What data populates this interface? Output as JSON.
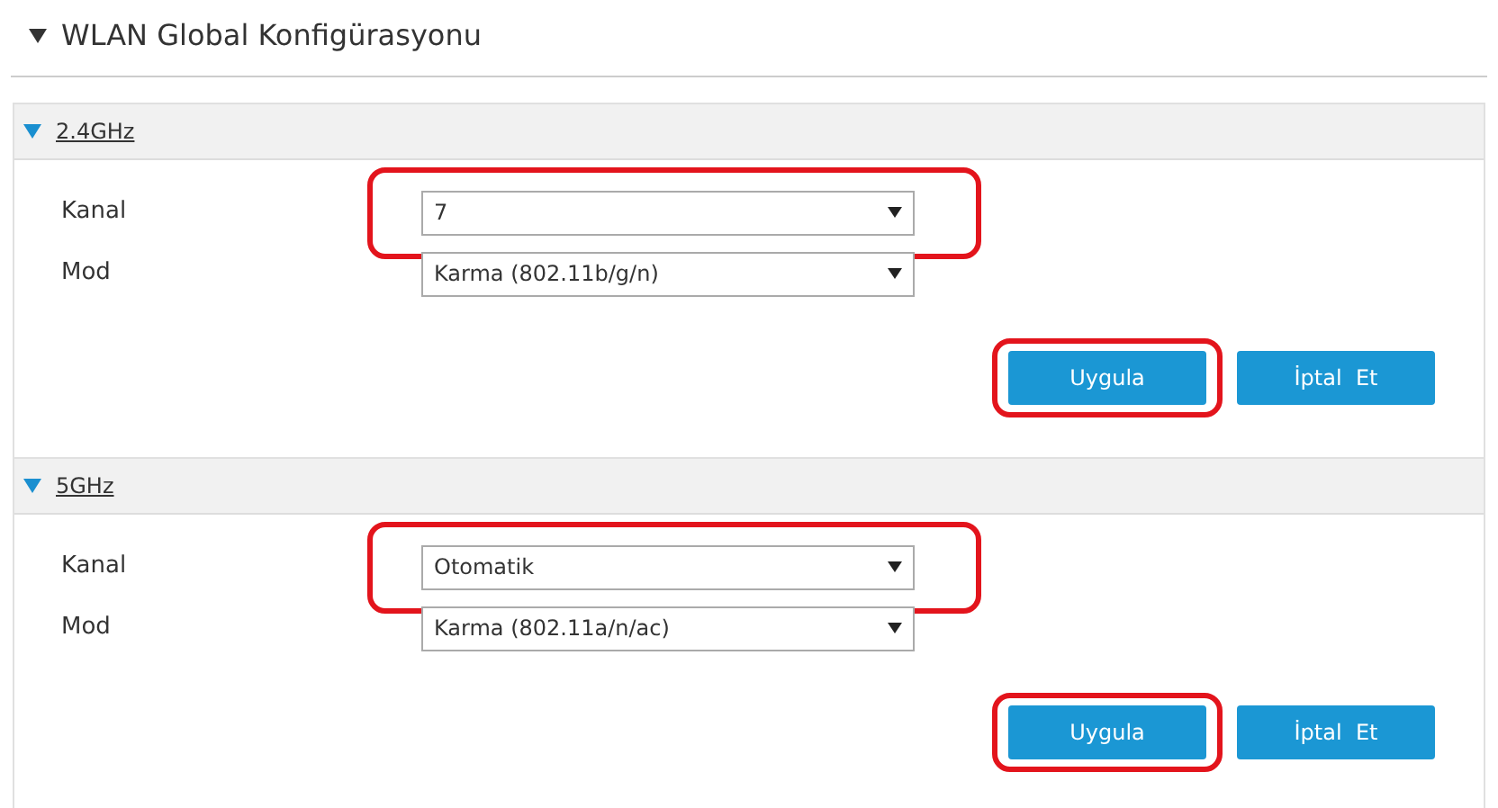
{
  "page_title": "WLAN Global Konfigürasyonu",
  "page_expanded": true,
  "sections": [
    {
      "title": "2.4GHz",
      "expanded": true,
      "fields": [
        {
          "label": "Kanal",
          "value": "7",
          "highlighted": true
        },
        {
          "label": "Mod",
          "value": "Karma (802.11b/g/n)",
          "highlighted": false
        }
      ],
      "buttons": [
        {
          "label": "Uygula",
          "highlighted": true
        },
        {
          "label": "İptal  Et",
          "highlighted": false
        }
      ]
    },
    {
      "title": "5GHz",
      "expanded": true,
      "fields": [
        {
          "label": "Kanal",
          "value": "Otomatik",
          "highlighted": true
        },
        {
          "label": "Mod",
          "value": "Karma (802.11a/n/ac)",
          "highlighted": false
        }
      ],
      "buttons": [
        {
          "label": "Uygula",
          "highlighted": true
        },
        {
          "label": "İptal  Et",
          "highlighted": false
        }
      ]
    }
  ]
}
